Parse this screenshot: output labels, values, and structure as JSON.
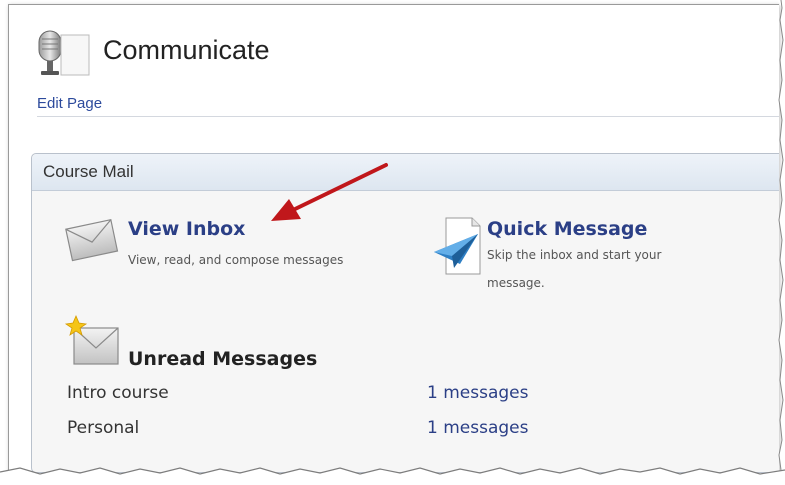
{
  "page": {
    "title": "Communicate",
    "edit_link": "Edit Page",
    "icon": "microphone-icon"
  },
  "course_mail": {
    "panel_title": "Course Mail",
    "view_inbox": {
      "label": "View Inbox",
      "description": "View, read, and compose messages",
      "icon": "envelope-icon"
    },
    "quick_message": {
      "label": "Quick Message",
      "description_line1": "Skip the inbox and start your",
      "description_line2": "message.",
      "icon": "paper-plane-icon"
    },
    "unread": {
      "title": "Unread Messages",
      "icon": "new-mail-icon",
      "rows": [
        {
          "name": "Intro course",
          "count": "1 messages"
        },
        {
          "name": "Personal",
          "count": "1 messages"
        }
      ]
    }
  },
  "annotation": {
    "arrow_color": "#c0171b",
    "points_to": "View Inbox"
  },
  "colors": {
    "link": "#2b3f86",
    "panel_header": "#dde6f0",
    "panel_border": "#b9c1cc"
  }
}
